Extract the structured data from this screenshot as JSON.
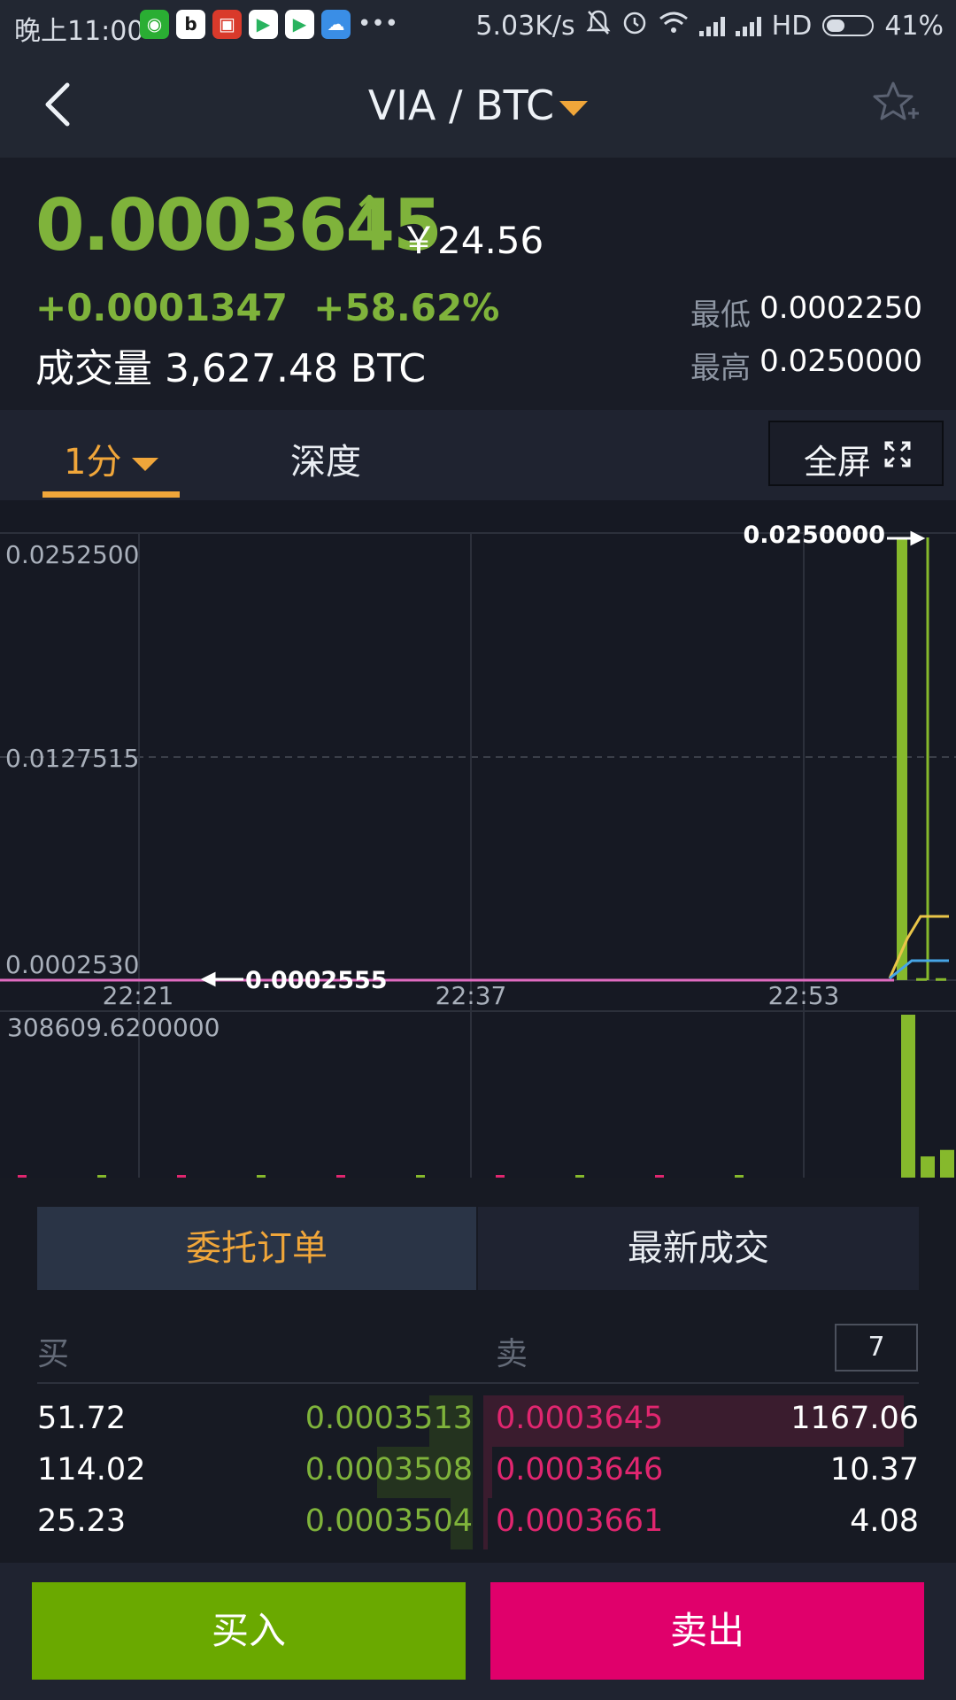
{
  "status_bar": {
    "time": "晚上11:00",
    "net_speed": "5.03K/s",
    "hd": "HD",
    "battery": "41%",
    "battery_level": 0.41,
    "more": "•••"
  },
  "header": {
    "title": "VIA / BTC"
  },
  "ticker": {
    "price": "0.0003645",
    "arrow": "↑",
    "cny": "￥24.56",
    "change_abs": "+0.0001347",
    "change_pct": "+58.62%",
    "volume_label": "成交量",
    "volume_value": "3,627.48 BTC",
    "low_label": "最低",
    "low_value": "0.0002250",
    "high_label": "最高",
    "high_value": "0.0250000"
  },
  "tabs": {
    "interval": "1分",
    "depth": "深度",
    "fullscreen": "全屏"
  },
  "chart_data": {
    "type": "line",
    "y_ticks": [
      "0.0252500",
      "0.0127515",
      "0.0002530"
    ],
    "x_ticks": [
      "22:21",
      "22:37",
      "22:53"
    ],
    "max_marker": "0.0250000",
    "min_marker": "0.0002555",
    "volume_max_label": "308609.6200000",
    "ylim": [
      0.000253,
      0.02525
    ],
    "price_series": [
      0.0002555,
      0.0002555,
      0.0002555,
      0.0002555,
      0.0002555,
      0.0002555,
      0.0002555,
      0.0002555,
      0.0002555,
      0.0002555,
      0.025,
      0.0003645,
      0.0003645
    ],
    "volume_series": [
      0.01,
      0.01,
      0.01,
      0.01,
      0.01,
      0.01,
      0.01,
      0.01,
      0.01,
      0.01,
      1.0,
      0.13,
      0.17
    ],
    "colors": {
      "up": "#86b92c",
      "down": "#e0266f",
      "price_line": "#ffffff"
    }
  },
  "order_tabs": {
    "active": "委托订单",
    "inactive": "最新成交"
  },
  "book": {
    "buy_label": "买",
    "sell_label": "卖",
    "depth_value": "7",
    "rows": [
      {
        "bid_qty": "51.72",
        "bid_price": "0.0003513",
        "ask_price": "0.0003645",
        "ask_qty": "1167.06",
        "bid_depth": 0.1,
        "ask_depth": 0.97
      },
      {
        "bid_qty": "114.02",
        "bid_price": "0.0003508",
        "ask_price": "0.0003646",
        "ask_qty": "10.37",
        "bid_depth": 0.22,
        "ask_depth": 0.02
      },
      {
        "bid_qty": "25.23",
        "bid_price": "0.0003504",
        "ask_price": "0.0003661",
        "ask_qty": "4.08",
        "bid_depth": 0.05,
        "ask_depth": 0.01
      }
    ]
  },
  "actions": {
    "buy": "买入",
    "sell": "卖出"
  }
}
